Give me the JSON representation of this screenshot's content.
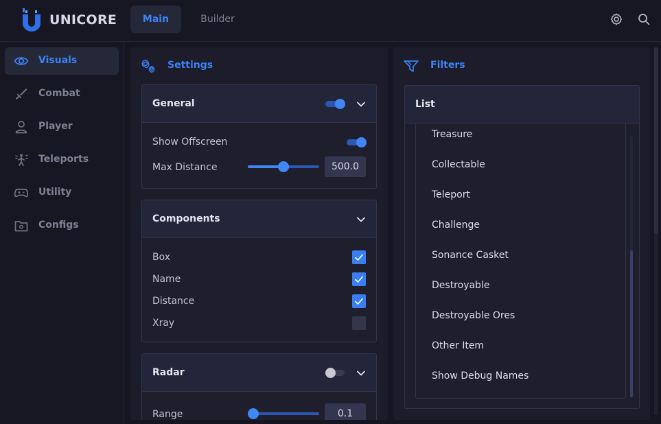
{
  "app": {
    "brand": "UNICORE",
    "accent": "#3d82f5"
  },
  "header": {
    "tabs": [
      {
        "label": "Main",
        "active": true
      },
      {
        "label": "Builder",
        "active": false
      }
    ],
    "icons": [
      "gear-icon",
      "search-icon"
    ]
  },
  "sidebar": {
    "items": [
      {
        "label": "Visuals",
        "icon": "eye-icon",
        "active": true
      },
      {
        "label": "Combat",
        "icon": "sword-icon",
        "active": false
      },
      {
        "label": "Player",
        "icon": "user-icon",
        "active": false
      },
      {
        "label": "Teleports",
        "icon": "teleport-icon",
        "active": false
      },
      {
        "label": "Utility",
        "icon": "gamepad-icon",
        "active": false
      },
      {
        "label": "Configs",
        "icon": "folder-gear-icon",
        "active": false
      }
    ]
  },
  "settings": {
    "title": "Settings",
    "general": {
      "title": "General",
      "enabled": true,
      "show_offscreen_label": "Show Offscreen",
      "show_offscreen": true,
      "max_distance_label": "Max Distance",
      "max_distance_value": "500.0",
      "max_distance_fraction": 0.5
    },
    "components": {
      "title": "Components",
      "items": [
        {
          "label": "Box",
          "checked": true
        },
        {
          "label": "Name",
          "checked": true
        },
        {
          "label": "Distance",
          "checked": true
        },
        {
          "label": "Xray",
          "checked": false
        }
      ]
    },
    "radar": {
      "title": "Radar",
      "enabled": false,
      "range_label": "Range",
      "range_value": "0.1",
      "range_fraction": 0.0
    }
  },
  "filters": {
    "title": "Filters",
    "list_title": "List",
    "items": [
      "Treasure",
      "Collectable",
      "Teleport",
      "Challenge",
      "Sonance Casket",
      "Destroyable",
      "Destroyable Ores",
      "Other Item",
      "Show Debug Names"
    ]
  }
}
